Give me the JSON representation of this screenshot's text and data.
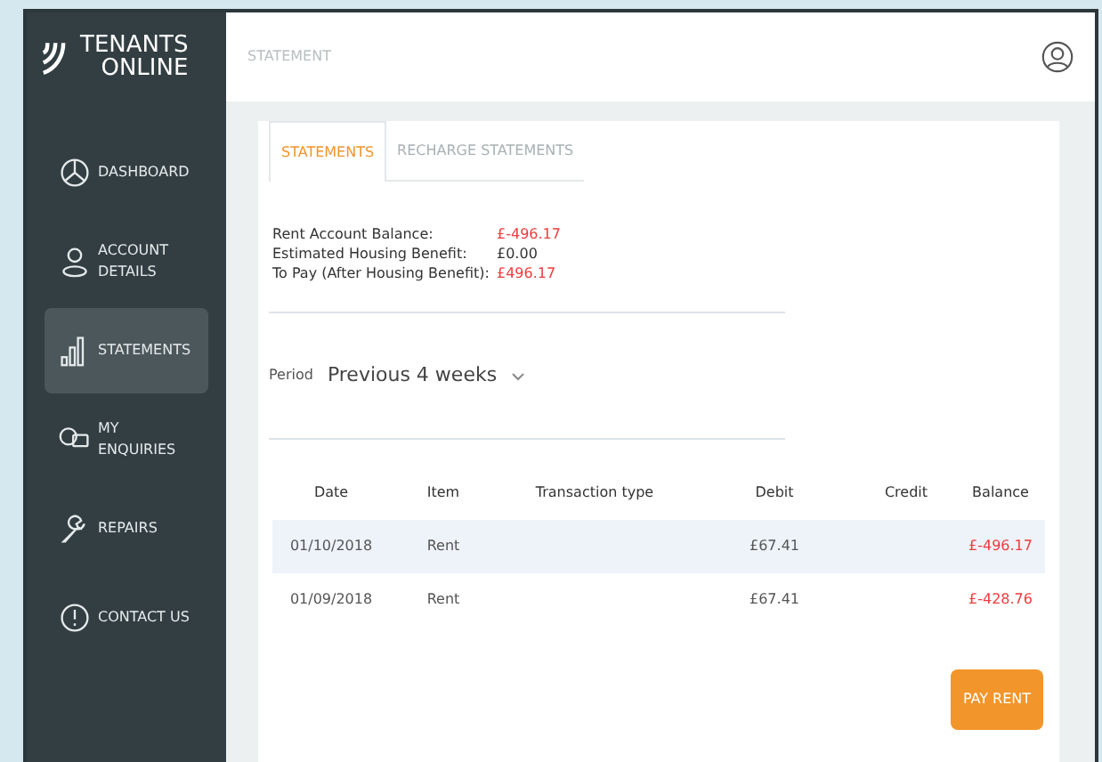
{
  "logo": {
    "line1": "TENANTS",
    "line2": "ONLINE"
  },
  "sidebar": {
    "items": [
      {
        "label": "DASHBOARD",
        "kind": "pie",
        "selected": false
      },
      {
        "label": "ACCOUNT DETAILS",
        "kind": "person",
        "selected": false
      },
      {
        "label": "STATEMENTS",
        "kind": "bars",
        "selected": true
      },
      {
        "label": "MY ENQUIRIES",
        "kind": "chat",
        "selected": false
      },
      {
        "label": "REPAIRS",
        "kind": "wrench",
        "selected": false
      },
      {
        "label": "CONTACT US",
        "kind": "alert",
        "selected": false
      }
    ]
  },
  "header": {
    "title": "STATEMENT"
  },
  "tabs": [
    {
      "label": "STATEMENTS",
      "selected": true
    },
    {
      "label": "RECHARGE STATEMENTS",
      "selected": false
    }
  ],
  "summary": [
    {
      "label": "Rent Account Balance:",
      "value": "£-496.17",
      "alert": true
    },
    {
      "label": "Estimated Housing Benefit:",
      "value": "£0.00",
      "alert": false
    },
    {
      "label": "To Pay (After Housing Benefit):",
      "value": "£496.17",
      "alert": true
    }
  ],
  "period": {
    "label": "Period",
    "value": "Previous 4 weeks"
  },
  "table": {
    "columns": [
      "Date",
      "Item",
      "Transaction type",
      "Debit",
      "Credit",
      "Balance"
    ],
    "rows": [
      {
        "cells": [
          "01/10/2018",
          "Rent",
          "",
          "£67.41",
          "",
          "£-496.17"
        ],
        "selected": true
      },
      {
        "cells": [
          "01/09/2018",
          "Rent",
          "",
          "£67.41",
          "",
          "£-428.76"
        ],
        "selected": false
      }
    ]
  },
  "pay_button": "PAY RENT"
}
